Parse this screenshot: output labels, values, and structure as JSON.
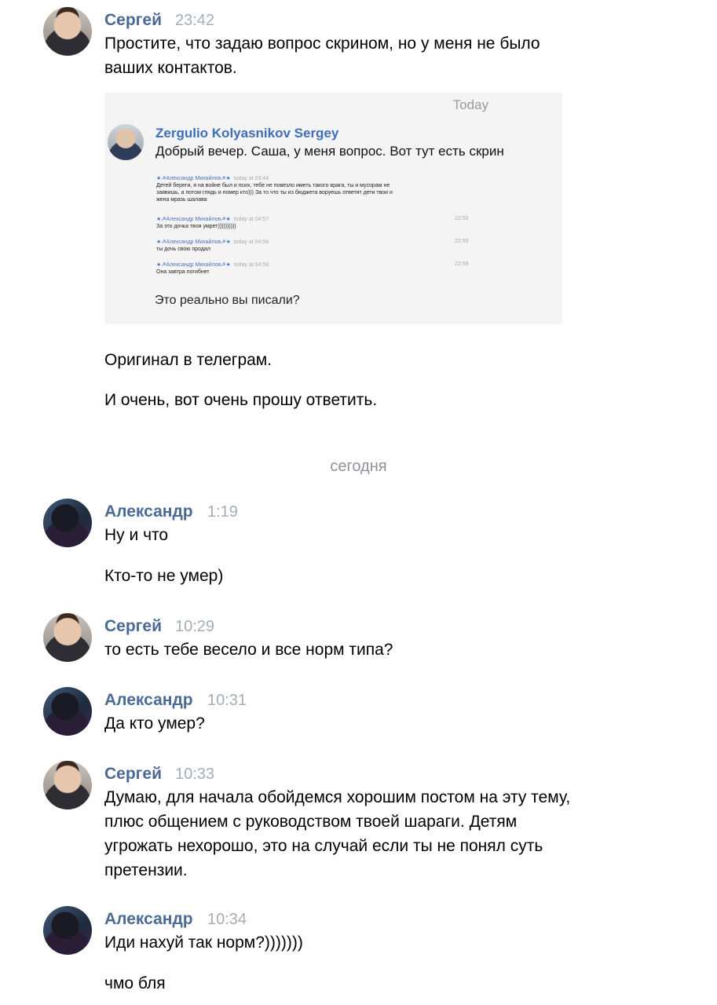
{
  "messages": [
    {
      "name": "Сергей",
      "time": "23:42",
      "lines": [
        "Простите, что задаю вопрос скрином, но у меня не было",
        "ваших контактов."
      ]
    },
    {
      "name": "Сергей",
      "time": "",
      "lines": [
        "Оригинал в телеграм."
      ]
    },
    {
      "name": "Сергей",
      "time": "",
      "lines": [
        "И очень, вот очень прошу ответить."
      ]
    }
  ],
  "first": {
    "name": "Сергей",
    "time": "23:42",
    "line1": "Простите, что задаю вопрос скрином, но у меня не было",
    "line2": "ваших контактов.",
    "after1": "Оригинал в телеграм.",
    "after2": "И очень, вот очень прошу ответить."
  },
  "screenshot": {
    "today_label": "Today",
    "sender": "Zergulio Kolyasnikov Sergey",
    "text": "Добрый вечер. Саша, у меня вопрос. Вот тут есть скрин",
    "question": "Это реально вы писали?",
    "inner": [
      {
        "name": "★☭Александр Михайлов☭★",
        "ts": "today at 03:44",
        "right": "",
        "l1": "Детей береги, я на войне был и псих, тебе не повезло иметь такого врага, ты и мусорам не",
        "l2": "заявишь, а потом глядь и помер кто))) За то что ты из бюджета воруешь ответят дети твои и",
        "l3": "жена мразь шалава"
      },
      {
        "name": "★☭Александр Михайлов☭★",
        "ts": "today at 04:57",
        "right": "22:59",
        "l1": "За это дочка твоя умрет))))))))))",
        "l2": "",
        "l3": ""
      },
      {
        "name": "★☭Александр Михайлов☭★",
        "ts": "today at 04:58",
        "right": "22:59",
        "l1": "ты дочь свою продал",
        "l2": "",
        "l3": ""
      },
      {
        "name": "★☭Александр Михайлов☭★",
        "ts": "today at 04:58",
        "right": "22:59",
        "l1": "Она завтра погибнет",
        "l2": "",
        "l3": ""
      }
    ]
  },
  "divider": "сегодня",
  "group2": {
    "name": "Александр",
    "time": "1:19",
    "line1": "Ну и что",
    "line2": "Кто-то не умер)"
  },
  "group3": {
    "name": "Сергей",
    "time": "10:29",
    "line1": "то есть тебе весело и все норм типа?"
  },
  "group4": {
    "name": "Александр",
    "time": "10:31",
    "line1": "Да кто умер?"
  },
  "group5": {
    "name": "Сергей",
    "time": "10:33",
    "line1": "Думаю, для начала обойдемся хорошим постом на эту тему,",
    "line2": "плюс общением с руководством твоей шараги. Детям",
    "line3": "угрожать нехорошо, это на случай если ты не понял суть",
    "line4": "претензии."
  },
  "group6": {
    "name": "Александр",
    "time": "10:34",
    "line1": "Иди нахуй так норм?)))))))",
    "line2": "чмо бля"
  },
  "colors": {
    "name": "#4b6a96",
    "time": "#a5adb8",
    "link_in_shot": "#3d6eb8"
  },
  "icons": {
    "sergey_avatar": "avatar-sergey",
    "alexander_avatar": "avatar-alexander"
  }
}
